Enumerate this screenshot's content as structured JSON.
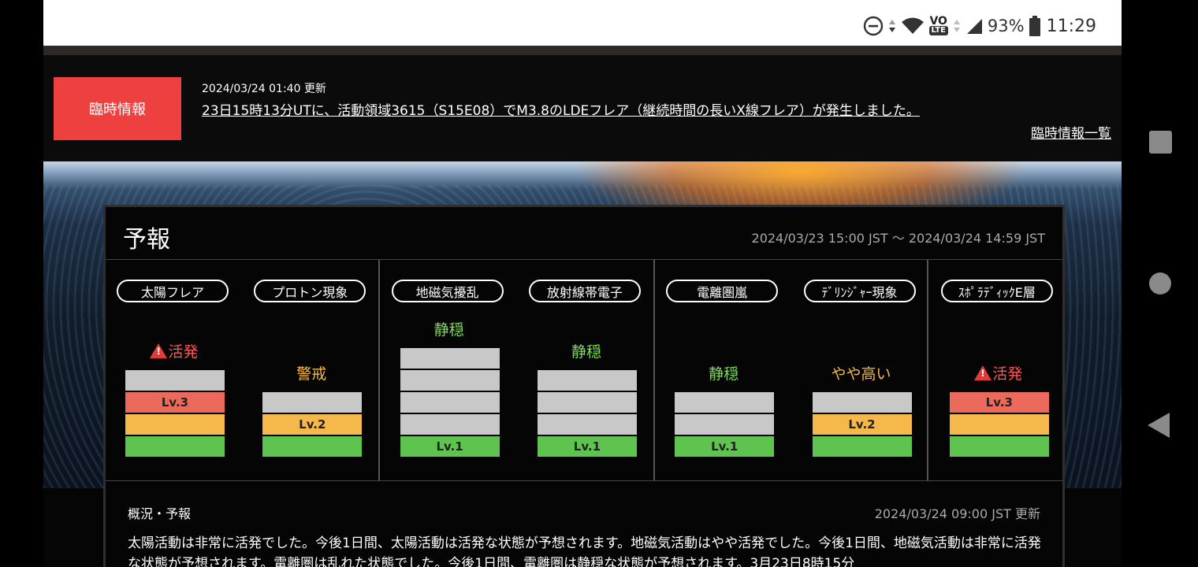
{
  "statusbar": {
    "battery": "93%",
    "time": "11:29",
    "lte": "LTE",
    "volte": "VO"
  },
  "alert": {
    "badge": "臨時情報",
    "date": "2024/03/24 01:40 更新",
    "message": "23日15時13分UTに、活動領域3615（S15E08）でM3.8のLDEフレア（継続時間の長いX線フレア）が発生しました。",
    "list_link": "臨時情報一覧"
  },
  "forecast": {
    "title": "予報",
    "range": "2024/03/23 15:00 JST 〜 2024/03/24 14:59 JST",
    "colors": {
      "lv1": "#5ec34f",
      "lv2": "#f5b84a",
      "lv3": "#ec6a5c",
      "empty": "#c8c8c8",
      "calm": "#7ed957",
      "amber": "#f5b84a",
      "red": "#ff5555"
    },
    "categories": [
      {
        "name": "太陽フレア",
        "status": "活発",
        "level": 3,
        "max": 4,
        "warning": true,
        "label": "Lv.3"
      },
      {
        "name": "プロトン現象",
        "status": "警戒",
        "level": 2,
        "max": 3,
        "warning": false,
        "label": "Lv.2"
      },
      {
        "name": "地磁気擾乱",
        "status": "静穏",
        "level": 1,
        "max": 5,
        "warning": false,
        "label": "Lv.1"
      },
      {
        "name": "放射線帯電子",
        "status": "静穏",
        "level": 1,
        "max": 4,
        "warning": false,
        "label": "Lv.1"
      },
      {
        "name": "電離圏嵐",
        "status": "静穏",
        "level": 1,
        "max": 3,
        "warning": false,
        "label": "Lv.1"
      },
      {
        "name": "ﾃﾞﾘﾝｼﾞｬｰ現象",
        "status": "やや高い",
        "level": 2,
        "max": 3,
        "warning": false,
        "label": "Lv.2"
      },
      {
        "name": "ｽﾎﾟﾗﾃﾞｨｯｸE層",
        "status": "活発",
        "level": 3,
        "max": 3,
        "warning": true,
        "label": "Lv.3"
      }
    ]
  },
  "summary": {
    "title": "概況・予報",
    "updated": "2024/03/24 09:00 JST 更新",
    "text": "太陽活動は非常に活発でした。今後1日間、太陽活動は活発な状態が予想されます。地磁気活動はやや活発でした。今後1日間、地磁気活動は非常に活発な状態が予想されます。電離圏は乱れた状態でした。今後1日間、電離圏は静穏な状態が予想されます。3月23日8時15分"
  }
}
